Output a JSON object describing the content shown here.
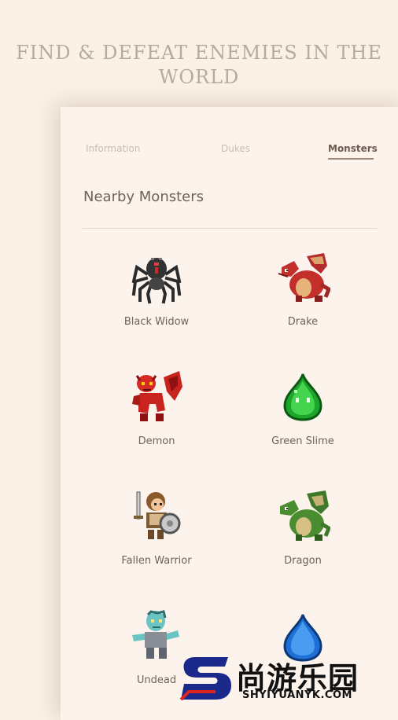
{
  "headline": {
    "line1": "FIND & DEFEAT ENEMIES IN THE",
    "line2": "WORLD"
  },
  "tabs": [
    {
      "label": "Information",
      "active": false
    },
    {
      "label": "Dukes",
      "active": false
    },
    {
      "label": "Monsters",
      "active": true
    }
  ],
  "section": {
    "title": "Nearby Monsters"
  },
  "monsters": [
    {
      "name": "Black Widow",
      "icon": "black-widow-spider-icon"
    },
    {
      "name": "Drake",
      "icon": "drake-icon"
    },
    {
      "name": "Demon",
      "icon": "demon-icon"
    },
    {
      "name": "Green Slime",
      "icon": "green-slime-icon"
    },
    {
      "name": "Fallen Warrior",
      "icon": "fallen-warrior-icon"
    },
    {
      "name": "Dragon",
      "icon": "dragon-icon"
    },
    {
      "name": "Undead",
      "icon": "undead-icon"
    },
    {
      "name": "",
      "icon": "blue-slime-icon"
    }
  ],
  "watermark": {
    "brand": "尚游乐园",
    "url": "SHYIYUANYK.COM"
  },
  "colors": {
    "background": "#fbf1e6",
    "card": "#fcf4ec",
    "text": "#6f625a",
    "active_tab": "#6d5a4e",
    "inactive_tab": "#c9bcb2"
  }
}
